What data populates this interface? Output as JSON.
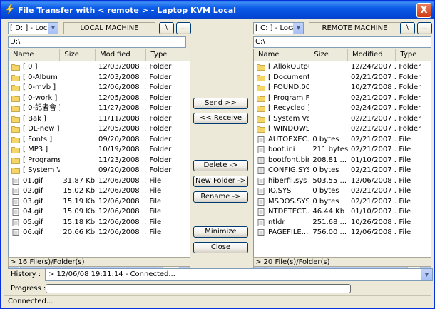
{
  "window": {
    "title": "File Transfer with < remote > - Laptop KVM Local",
    "close_label": "X"
  },
  "left": {
    "drive": "[ D: ] - Local",
    "machine_label": "LOCAL MACHINE",
    "root_btn": "\\",
    "browse_btn": "...",
    "path": "D:\\",
    "columns": [
      "Name",
      "Size",
      "Modified",
      "Type"
    ],
    "rows": [
      {
        "icon": "folder",
        "name": "[ 0 ]",
        "size": "",
        "modified": "12/03/2008 ...",
        "type": "Folder"
      },
      {
        "icon": "folder",
        "name": "[ 0-Album ]",
        "size": "",
        "modified": "12/03/2008 ...",
        "type": "Folder"
      },
      {
        "icon": "folder",
        "name": "[ 0-mvb ]",
        "size": "",
        "modified": "12/06/2008 ...",
        "type": "Folder"
      },
      {
        "icon": "folder",
        "name": "[ 0-work ]",
        "size": "",
        "modified": "12/05/2008 ...",
        "type": "Folder"
      },
      {
        "icon": "folder",
        "name": "[ 0-記者會 ]",
        "size": "",
        "modified": "11/27/2008 ...",
        "type": "Folder"
      },
      {
        "icon": "folder",
        "name": "[ Bak ]",
        "size": "",
        "modified": "11/11/2008 ...",
        "type": "Folder"
      },
      {
        "icon": "folder",
        "name": "[ DL-new ]",
        "size": "",
        "modified": "12/05/2008 ...",
        "type": "Folder"
      },
      {
        "icon": "folder",
        "name": "[ Fonts ]",
        "size": "",
        "modified": "09/20/2008 ...",
        "type": "Folder"
      },
      {
        "icon": "folder",
        "name": "[ MP3 ]",
        "size": "",
        "modified": "10/19/2008 ...",
        "type": "Folder"
      },
      {
        "icon": "folder",
        "name": "[ Programs ]",
        "size": "",
        "modified": "11/23/2008 ...",
        "type": "Folder"
      },
      {
        "icon": "folder",
        "name": "[ System V...",
        "size": "",
        "modified": "09/20/2008 ...",
        "type": "Folder"
      },
      {
        "icon": "file",
        "name": "01.gif",
        "size": "31.87 Kb",
        "modified": "12/06/2008 ...",
        "type": "File"
      },
      {
        "icon": "file",
        "name": "02.gif",
        "size": "15.02 Kb",
        "modified": "12/06/2008 ...",
        "type": "File"
      },
      {
        "icon": "file",
        "name": "03.gif",
        "size": "15.19 Kb",
        "modified": "12/06/2008 ...",
        "type": "File"
      },
      {
        "icon": "file",
        "name": "04.gif",
        "size": "15.09 Kb",
        "modified": "12/06/2008 ...",
        "type": "File"
      },
      {
        "icon": "file",
        "name": "05.gif",
        "size": "15.18 Kb",
        "modified": "12/06/2008 ...",
        "type": "File"
      },
      {
        "icon": "file",
        "name": "06.gif",
        "size": "20.66 Kb",
        "modified": "12/06/2008 ...",
        "type": "File"
      }
    ],
    "count": "> 16 File(s)/Folder(s)"
  },
  "right": {
    "drive": "[ C: ] - Local",
    "machine_label": "REMOTE MACHINE",
    "root_btn": "\\",
    "browse_btn": "...",
    "path": "C:\\",
    "columns": [
      "Name",
      "Size",
      "Modified",
      "Type"
    ],
    "rows": [
      {
        "icon": "folder",
        "name": "[ AllokOutput ]",
        "size": "",
        "modified": "12/24/2007 ...",
        "type": "Folder"
      },
      {
        "icon": "folder",
        "name": "[ Documents...",
        "size": "",
        "modified": "02/21/2007 ...",
        "type": "Folder"
      },
      {
        "icon": "folder",
        "name": "[ FOUND.00...",
        "size": "",
        "modified": "10/27/2008 ...",
        "type": "Folder"
      },
      {
        "icon": "folder",
        "name": "[ Program Fil...",
        "size": "",
        "modified": "02/21/2007 ...",
        "type": "Folder"
      },
      {
        "icon": "folder",
        "name": "[ Recycled ]",
        "size": "",
        "modified": "02/24/2007 ...",
        "type": "Folder"
      },
      {
        "icon": "folder",
        "name": "[ System Vol...",
        "size": "",
        "modified": "02/21/2007 ...",
        "type": "Folder"
      },
      {
        "icon": "folder",
        "name": "[ WINDOWS ]",
        "size": "",
        "modified": "02/21/2007 ...",
        "type": "Folder"
      },
      {
        "icon": "file",
        "name": "AUTOEXEC....",
        "size": "0 bytes",
        "modified": "02/21/2007 ...",
        "type": "File"
      },
      {
        "icon": "file",
        "name": "boot.ini",
        "size": "211 bytes",
        "modified": "02/21/2007 ...",
        "type": "File"
      },
      {
        "icon": "file",
        "name": "bootfont.bin",
        "size": "208.81 ...",
        "modified": "01/10/2007 ...",
        "type": "File"
      },
      {
        "icon": "file",
        "name": "CONFIG.SYS",
        "size": "0 bytes",
        "modified": "02/21/2007 ...",
        "type": "File"
      },
      {
        "icon": "file",
        "name": "hiberfil.sys",
        "size": "503.55 ...",
        "modified": "12/06/2008 ...",
        "type": "File"
      },
      {
        "icon": "file",
        "name": "IO.SYS",
        "size": "0 bytes",
        "modified": "02/21/2007 ...",
        "type": "File"
      },
      {
        "icon": "file",
        "name": "MSDOS.SYS",
        "size": "0 bytes",
        "modified": "02/21/2007 ...",
        "type": "File"
      },
      {
        "icon": "file",
        "name": "NTDETECT....",
        "size": "46.44 Kb",
        "modified": "01/10/2007 ...",
        "type": "File"
      },
      {
        "icon": "file",
        "name": "ntldr",
        "size": "251.68 ...",
        "modified": "10/26/2008 ...",
        "type": "File"
      },
      {
        "icon": "file",
        "name": "PAGEFILE....",
        "size": "756.00 ...",
        "modified": "12/06/2008 ...",
        "type": "File"
      }
    ],
    "count": "> 20 File(s)/Folder(s)"
  },
  "actions": {
    "send": "Send >>",
    "receive": "<< Receive",
    "delete": "Delete ->",
    "new_folder": "New Folder ->",
    "rename": "Rename ->",
    "minimize": "Minimize",
    "close": "Close"
  },
  "history": {
    "label": "History :",
    "value": "> 12/06/08 19:11:14 -  Connected..."
  },
  "progress": {
    "label": "Progress :",
    "percent": 0
  },
  "status": "Connected...",
  "icons": {
    "title": "lightning-icon",
    "folder": "folder-icon",
    "file": "file-icon",
    "dropdown": "chevron-down-icon"
  },
  "colors": {
    "titlebar": "#0347d4",
    "folder": "#f5d565",
    "window": "#ece9d8"
  }
}
